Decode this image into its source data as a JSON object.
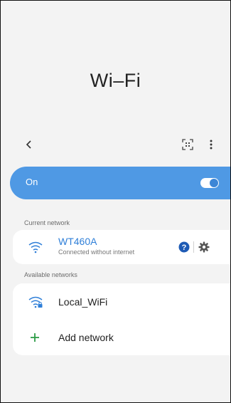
{
  "header": {
    "title": "Wi–Fi"
  },
  "toolbar": {
    "back_icon": "chevron-left-icon",
    "qr_icon": "qr-scan-icon",
    "more_icon": "more-vertical-icon"
  },
  "wifi_toggle": {
    "label": "On",
    "state": true,
    "accent": "#4f99e4"
  },
  "current_network": {
    "section_label": "Current network",
    "name": "WT460A",
    "status": "Connected without internet",
    "name_color": "#2f7fd8",
    "help_icon": "help-circle-icon",
    "settings_icon": "gear-icon"
  },
  "available_networks": {
    "section_label": "Available networks",
    "items": [
      {
        "name": "Local_WiFi",
        "icon": "wifi-lock-icon"
      }
    ],
    "add_label": "Add network"
  }
}
